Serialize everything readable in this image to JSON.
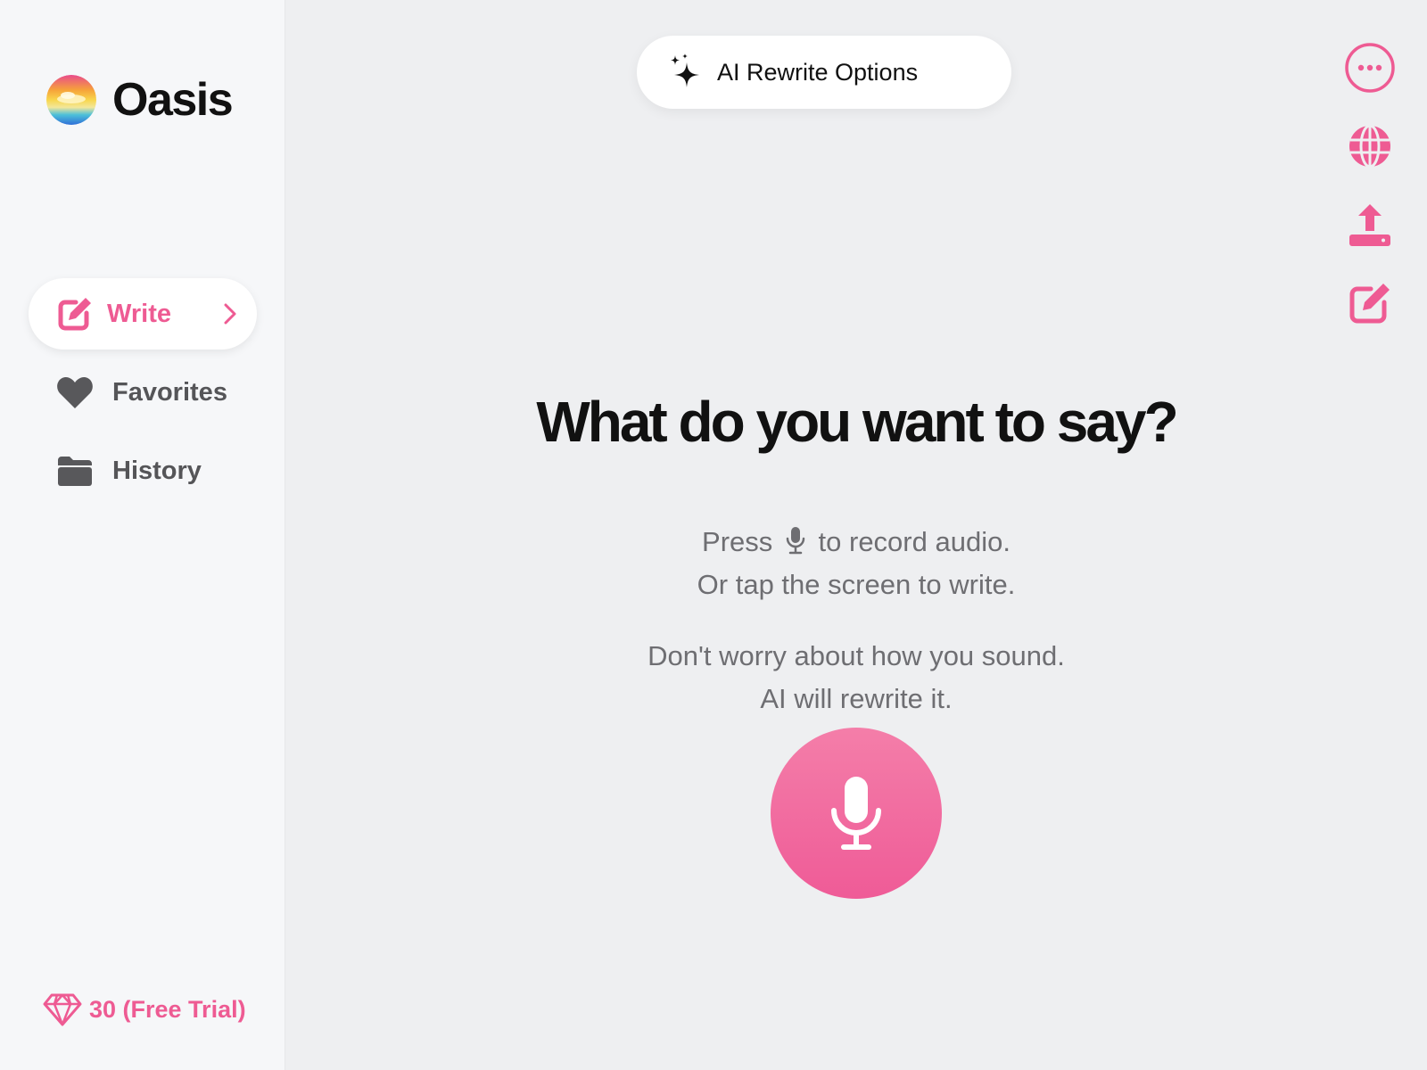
{
  "app": {
    "name": "Oasis"
  },
  "sidebar": {
    "items": [
      {
        "label": "Write",
        "icon": "edit-icon",
        "active": true
      },
      {
        "label": "Favorites",
        "icon": "heart-icon",
        "active": false
      },
      {
        "label": "History",
        "icon": "folder-icon",
        "active": false
      }
    ],
    "credits": {
      "label": "30 (Free Trial)",
      "icon": "diamond-icon"
    }
  },
  "toolbar": {
    "rewrite_label": "AI Rewrite Options",
    "right_icons": [
      "more-icon",
      "globe-icon",
      "share-icon",
      "edit-icon"
    ]
  },
  "main": {
    "headline": "What do you want to say?",
    "instruction_line1_pre": "Press",
    "instruction_line1_post": "to record audio.",
    "instruction_line2": "Or tap the screen to write.",
    "reassure_line1": "Don't worry about how you sound.",
    "reassure_line2": "AI will rewrite it."
  },
  "colors": {
    "accent": "#ee5b93",
    "sidebar_bg": "#f6f7f9",
    "main_bg": "#eeeff1",
    "text_dark": "#111111",
    "text_muted": "#6e6e72",
    "nav_text": "#555558"
  }
}
